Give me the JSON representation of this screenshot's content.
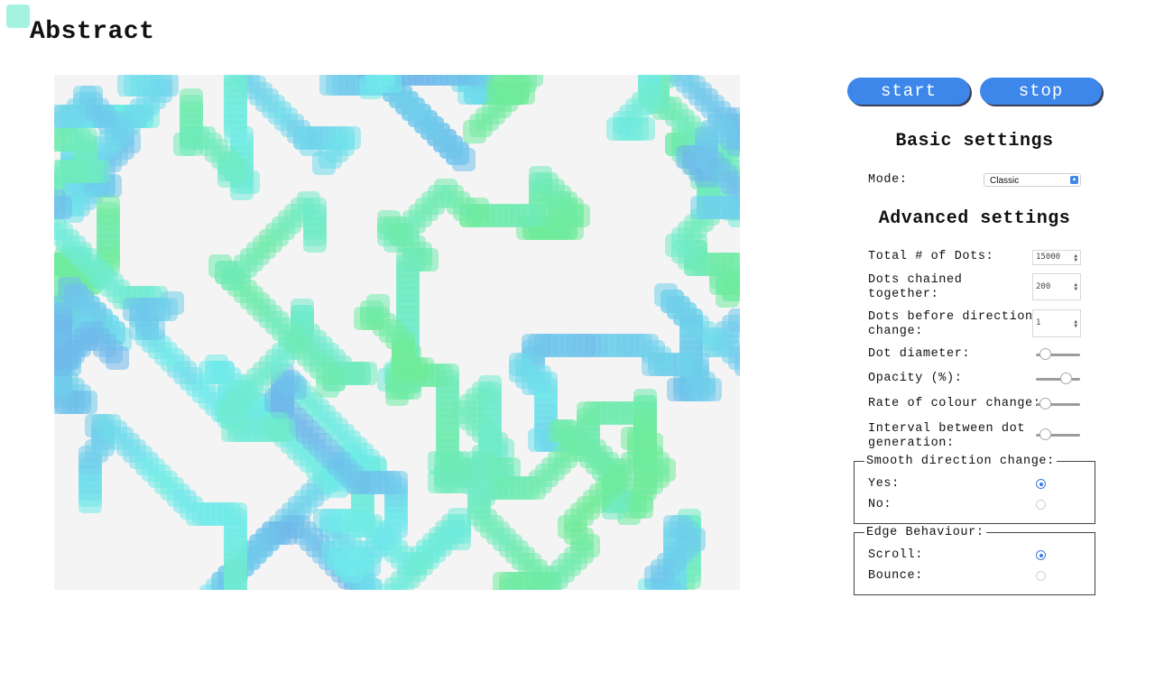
{
  "app": {
    "title": "Abstract"
  },
  "colors": {
    "accent": "#3d86ea",
    "logo": "#a6f2e1",
    "canvas_bg": "#f4f4f4"
  },
  "controls": {
    "start_label": "start",
    "stop_label": "stop"
  },
  "basic": {
    "heading": "Basic settings",
    "mode_label": "Mode:",
    "mode_value": "Classic"
  },
  "advanced": {
    "heading": "Advanced settings",
    "total_dots_label": "Total # of Dots:",
    "total_dots_value": "15000",
    "chained_label_1": "Dots chained",
    "chained_label_2": "together:",
    "chained_value": "200",
    "direction_label_1": "Dots before direction",
    "direction_label_2": "change:",
    "direction_value": "1",
    "diameter_label": "Dot diameter:",
    "diameter_level": 0.12,
    "opacity_label": "Opacity (%):",
    "opacity_level": 0.75,
    "colour_rate_label": "Rate of colour change:",
    "colour_rate_level": 0.12,
    "interval_label_1": "Interval between dot",
    "interval_label_2": "generation:",
    "interval_level": 0.12
  },
  "smooth": {
    "legend": "Smooth direction change:",
    "yes_label": "Yes:",
    "no_label": "No:",
    "selected": "yes"
  },
  "edge": {
    "legend": "Edge Behaviour:",
    "scroll_label": "Scroll:",
    "bounce_label": "Bounce:",
    "selected": "scroll"
  }
}
